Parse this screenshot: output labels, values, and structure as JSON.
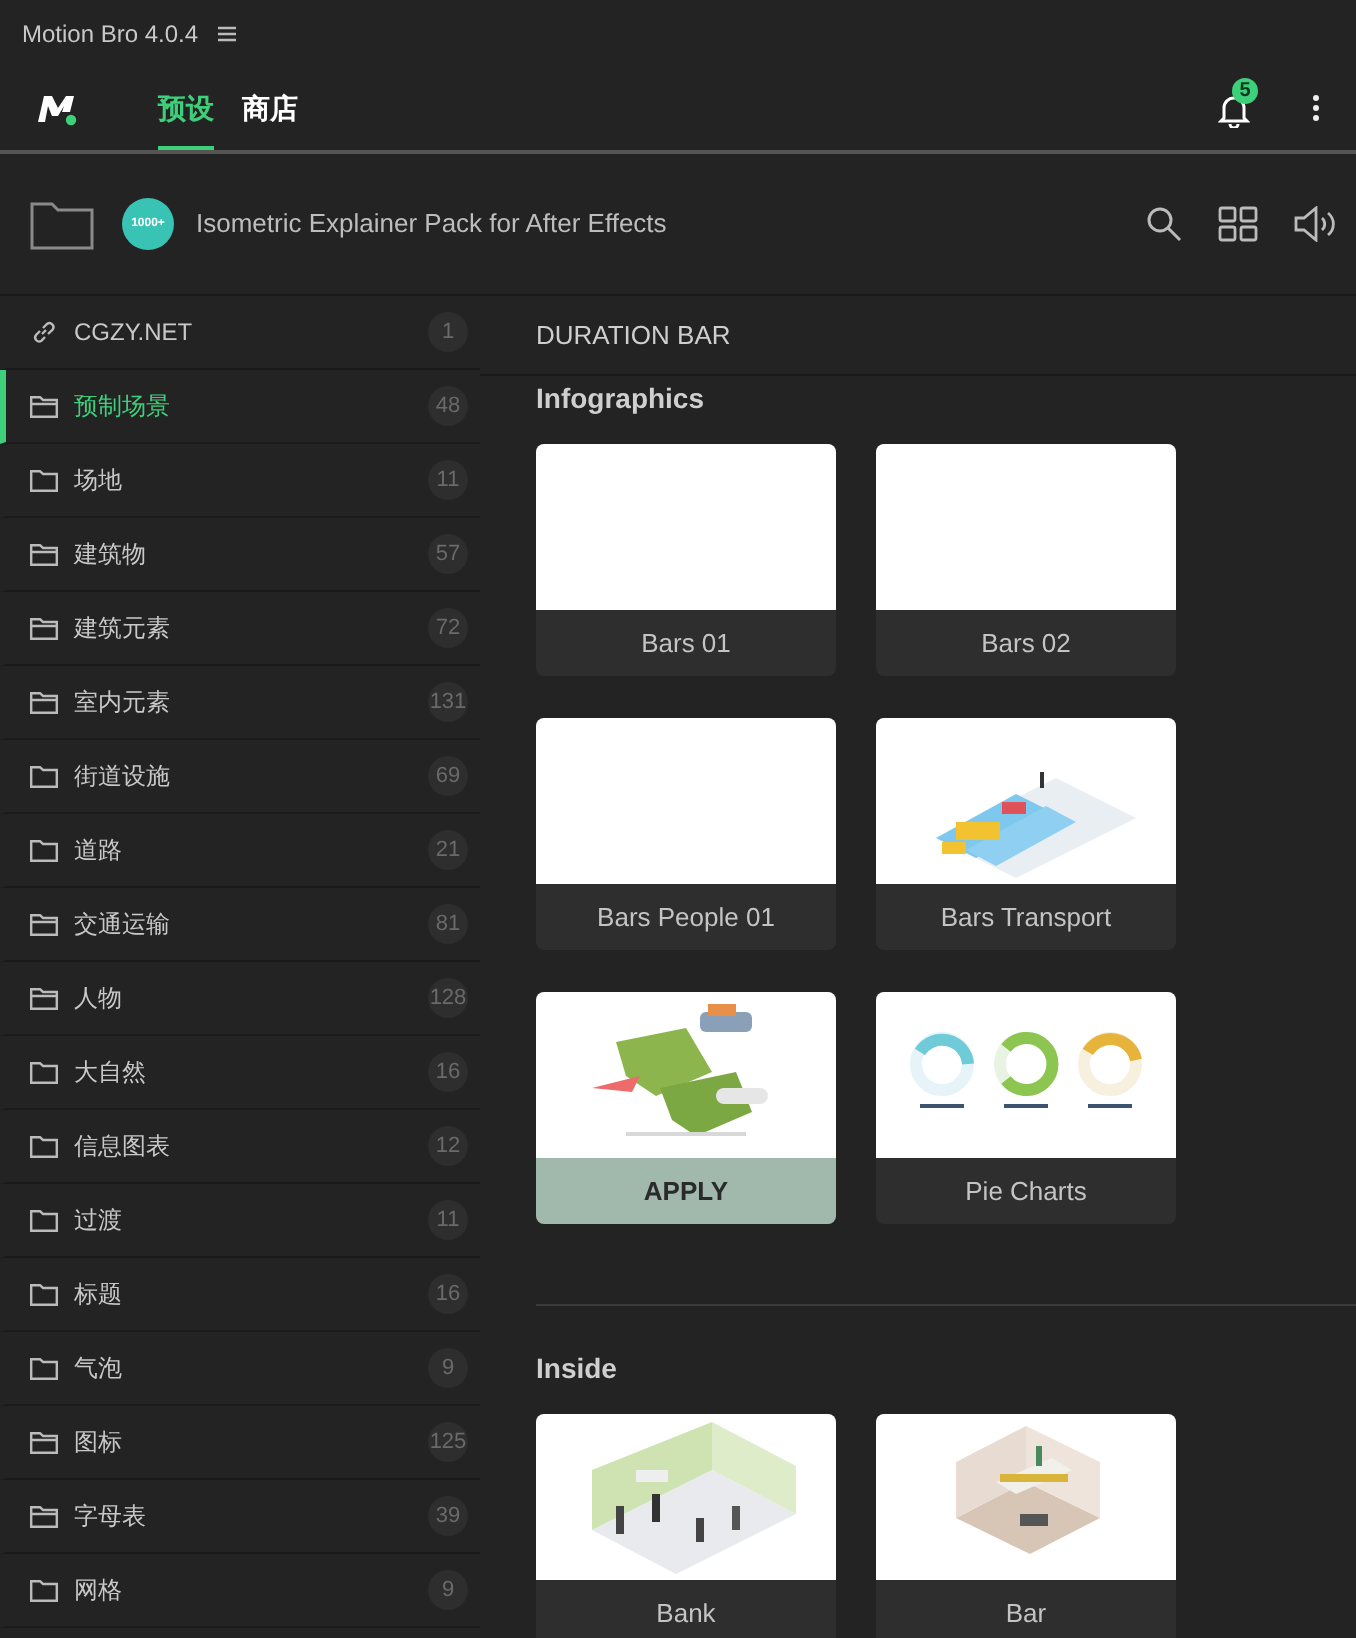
{
  "app": {
    "title": "Motion Bro 4.0.4"
  },
  "nav": {
    "tabs": [
      {
        "label": "预设",
        "selected": true
      },
      {
        "label": "商店",
        "selected": false
      }
    ],
    "notifications": "5"
  },
  "pack": {
    "badge": "1000+",
    "title": "Isometric Explainer Pack for After Effects"
  },
  "sidebar": {
    "items": [
      {
        "kind": "link",
        "label": "CGZY.NET",
        "count": "1",
        "selected": false
      },
      {
        "kind": "folders",
        "label": "预制场景",
        "count": "48",
        "selected": true
      },
      {
        "kind": "folder",
        "label": "场地",
        "count": "11",
        "selected": false
      },
      {
        "kind": "folders",
        "label": "建筑物",
        "count": "57",
        "selected": false
      },
      {
        "kind": "folders",
        "label": "建筑元素",
        "count": "72",
        "selected": false
      },
      {
        "kind": "folders",
        "label": "室内元素",
        "count": "131",
        "selected": false
      },
      {
        "kind": "folder",
        "label": "街道设施",
        "count": "69",
        "selected": false
      },
      {
        "kind": "folder",
        "label": "道路",
        "count": "21",
        "selected": false
      },
      {
        "kind": "folders",
        "label": "交通运输",
        "count": "81",
        "selected": false
      },
      {
        "kind": "folders",
        "label": "人物",
        "count": "128",
        "selected": false
      },
      {
        "kind": "folder",
        "label": "大自然",
        "count": "16",
        "selected": false
      },
      {
        "kind": "folder",
        "label": "信息图表",
        "count": "12",
        "selected": false
      },
      {
        "kind": "folder",
        "label": "过渡",
        "count": "11",
        "selected": false
      },
      {
        "kind": "folder",
        "label": "标题",
        "count": "16",
        "selected": false
      },
      {
        "kind": "folder",
        "label": "气泡",
        "count": "9",
        "selected": false
      },
      {
        "kind": "folders",
        "label": "图标",
        "count": "125",
        "selected": false
      },
      {
        "kind": "folders",
        "label": "字母表",
        "count": "39",
        "selected": false
      },
      {
        "kind": "folder",
        "label": "网格",
        "count": "9",
        "selected": false
      }
    ]
  },
  "main": {
    "header": "DURATION BAR",
    "sections": [
      {
        "title": "Infographics",
        "cards": [
          {
            "label": "Bars 01",
            "kind": "blank",
            "highlighted": false
          },
          {
            "label": "Bars 02",
            "kind": "blank",
            "highlighted": false
          },
          {
            "label": "Bars People 01",
            "kind": "blank",
            "highlighted": false
          },
          {
            "label": "Bars Transport",
            "kind": "picture",
            "highlighted": false
          },
          {
            "label": "APPLY",
            "kind": "picture",
            "highlighted": true
          },
          {
            "label": "Pie Charts",
            "kind": "picture",
            "highlighted": false
          }
        ]
      },
      {
        "title": "Inside",
        "cards": [
          {
            "label": "Bank",
            "kind": "picture",
            "highlighted": false
          },
          {
            "label": "Bar",
            "kind": "picture",
            "highlighted": false
          }
        ]
      }
    ]
  }
}
